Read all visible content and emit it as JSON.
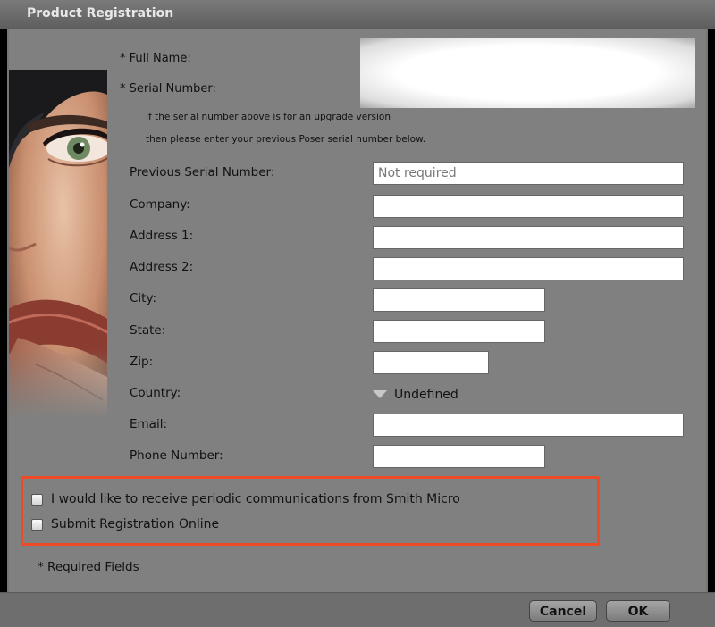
{
  "window": {
    "title": "Product Registration"
  },
  "form": {
    "full_name_label": "* Full Name:",
    "serial_label": "* Serial Number:",
    "upgrade_note_line1": "If the serial number above is for an upgrade version",
    "upgrade_note_line2": "then please enter your previous Poser serial number below.",
    "fields": {
      "previous_serial": {
        "label": "Previous Serial Number:",
        "value": "",
        "placeholder": "Not required"
      },
      "company": {
        "label": "Company:",
        "value": ""
      },
      "address1": {
        "label": "Address 1:",
        "value": ""
      },
      "address2": {
        "label": "Address 2:",
        "value": ""
      },
      "city": {
        "label": "City:",
        "value": ""
      },
      "state": {
        "label": "State:",
        "value": ""
      },
      "zip": {
        "label": "Zip:",
        "value": ""
      },
      "country": {
        "label": "Country:",
        "value": "Undefined"
      },
      "email": {
        "label": "Email:",
        "value": ""
      },
      "phone": {
        "label": "Phone Number:",
        "value": ""
      }
    },
    "checkboxes": {
      "communications": {
        "label": "I would like to receive periodic communications from Smith Micro",
        "checked": false
      },
      "submit_online": {
        "label": "Submit Registration Online",
        "checked": false
      }
    },
    "required_note": "* Required Fields"
  },
  "buttons": {
    "cancel": "Cancel",
    "ok": "OK"
  },
  "colors": {
    "highlight_border": "#ef4a26",
    "panel_bg": "#808080",
    "titlebar_text": "#e8e8e8"
  }
}
